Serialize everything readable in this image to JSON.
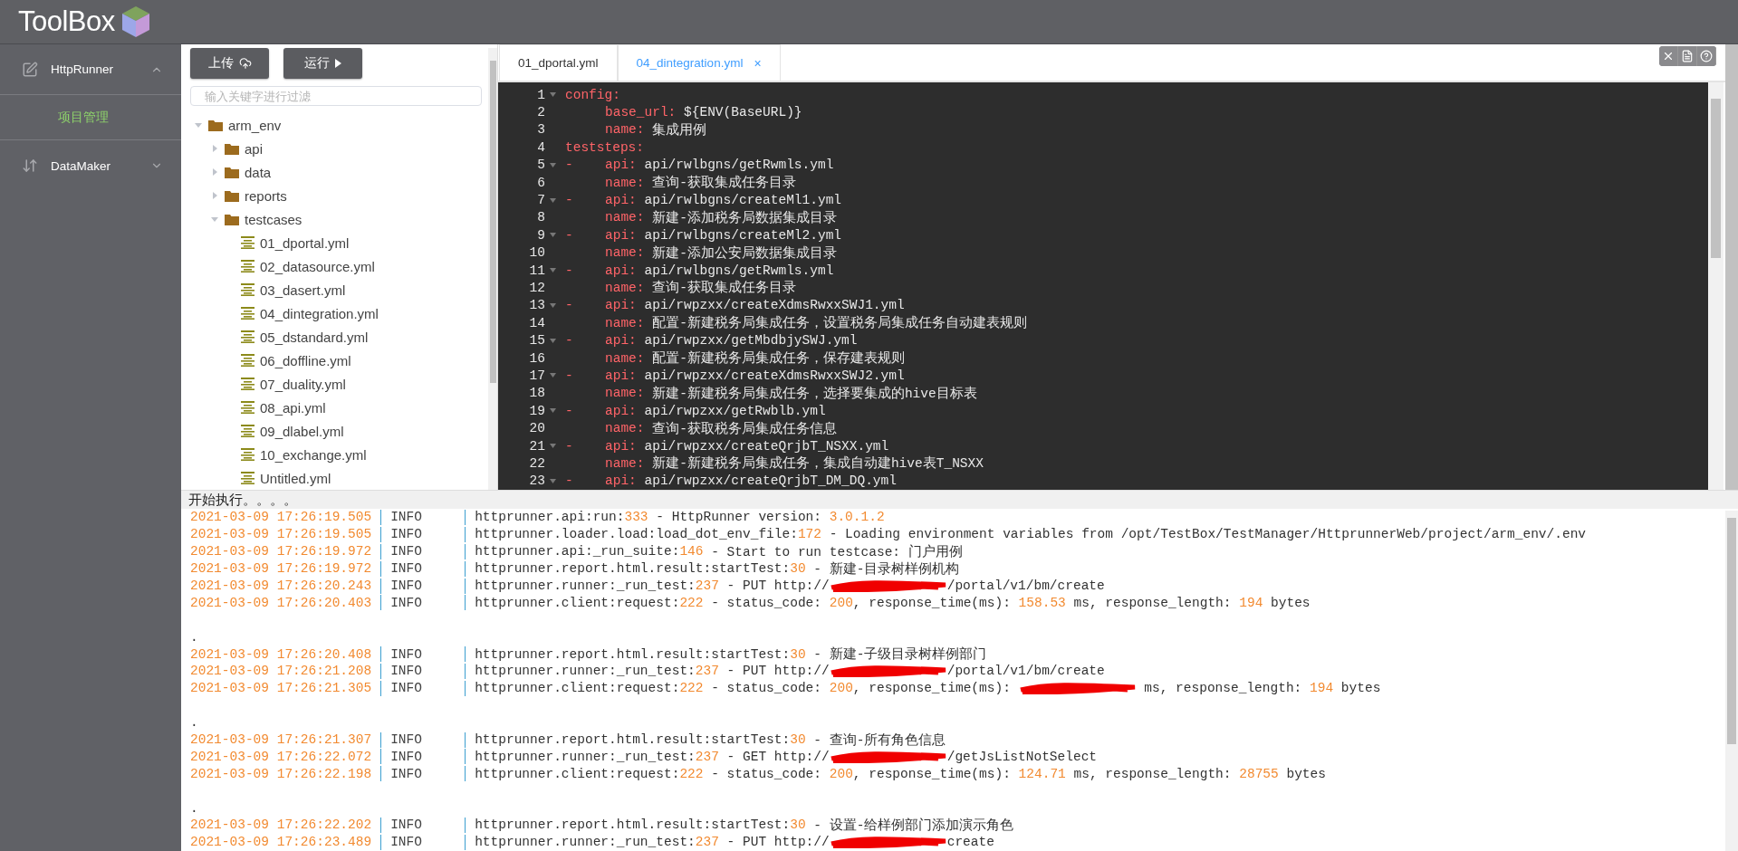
{
  "app": {
    "title": "ToolBox"
  },
  "sidebar": {
    "menus": [
      {
        "label": "HttpRunner",
        "expanded": true,
        "children": [
          {
            "label": "项目管理",
            "selected": true
          }
        ]
      },
      {
        "label": "DataMaker",
        "expanded": false
      }
    ]
  },
  "toolbar": {
    "buttons": [
      {
        "label": "上传",
        "kind": "upload"
      },
      {
        "label": "运行",
        "kind": "run"
      }
    ]
  },
  "filter": {
    "placeholder": "输入关键字进行过滤"
  },
  "file_tree": [
    {
      "label": "arm_env",
      "kind": "folder",
      "expanded": true,
      "children": [
        {
          "label": "api",
          "kind": "folder",
          "expanded": false
        },
        {
          "label": "data",
          "kind": "folder",
          "expanded": false
        },
        {
          "label": "reports",
          "kind": "folder",
          "expanded": false
        },
        {
          "label": "testcases",
          "kind": "folder",
          "expanded": true,
          "children": [
            {
              "label": "01_dportal.yml",
              "kind": "file"
            },
            {
              "label": "02_datasource.yml",
              "kind": "file"
            },
            {
              "label": "03_dasert.yml",
              "kind": "file"
            },
            {
              "label": "04_dintegration.yml",
              "kind": "file"
            },
            {
              "label": "05_dstandard.yml",
              "kind": "file"
            },
            {
              "label": "06_doffline.yml",
              "kind": "file"
            },
            {
              "label": "07_duality.yml",
              "kind": "file"
            },
            {
              "label": "08_api.yml",
              "kind": "file"
            },
            {
              "label": "09_dlabel.yml",
              "kind": "file"
            },
            {
              "label": "10_exchange.yml",
              "kind": "file"
            },
            {
              "label": "Untitled.yml",
              "kind": "file"
            }
          ]
        }
      ]
    }
  ],
  "editor": {
    "tabs": [
      {
        "label": "01_dportal.yml",
        "selected": false
      },
      {
        "label": "04_dintegration.yml",
        "selected": true,
        "close": "×"
      }
    ],
    "lines": [
      {
        "no": "1",
        "fold": true,
        "kind": "top",
        "key": "config:"
      },
      {
        "no": "2",
        "fold": false,
        "kind": "field",
        "key": "base_url:",
        "value": "${ENV(BaseURL)}"
      },
      {
        "no": "3",
        "fold": false,
        "kind": "field",
        "key": "name:",
        "value": "集成用例"
      },
      {
        "no": "4",
        "fold": false,
        "kind": "top",
        "key": "teststeps:"
      },
      {
        "no": "5",
        "fold": true,
        "kind": "item",
        "dash": "-",
        "key": "api:",
        "value": "api/rwlbgns/getRwmls.yml"
      },
      {
        "no": "6",
        "fold": false,
        "kind": "field",
        "key": "name:",
        "value": "查询-获取集成任务目录"
      },
      {
        "no": "7",
        "fold": true,
        "kind": "item",
        "dash": "-",
        "key": "api:",
        "value": "api/rwlbgns/createMl1.yml"
      },
      {
        "no": "8",
        "fold": false,
        "kind": "field",
        "key": "name:",
        "value": "新建-添加税务局数据集成目录"
      },
      {
        "no": "9",
        "fold": true,
        "kind": "item",
        "dash": "-",
        "key": "api:",
        "value": "api/rwlbgns/createMl2.yml"
      },
      {
        "no": "10",
        "fold": false,
        "kind": "field",
        "key": "name:",
        "value": "新建-添加公安局数据集成目录"
      },
      {
        "no": "11",
        "fold": true,
        "kind": "item",
        "dash": "-",
        "key": "api:",
        "value": "api/rwlbgns/getRwmls.yml"
      },
      {
        "no": "12",
        "fold": false,
        "kind": "field",
        "key": "name:",
        "value": "查询-获取集成任务目录"
      },
      {
        "no": "13",
        "fold": true,
        "kind": "item",
        "dash": "-",
        "key": "api:",
        "value": "api/rwpzxx/createXdmsRwxxSWJ1.yml"
      },
      {
        "no": "14",
        "fold": false,
        "kind": "field",
        "key": "name:",
        "value": "配置-新建税务局集成任务，设置税务局集成任务自动建表规则"
      },
      {
        "no": "15",
        "fold": true,
        "kind": "item",
        "dash": "-",
        "key": "api:",
        "value": "api/rwpzxx/getMbdbjySWJ.yml"
      },
      {
        "no": "16",
        "fold": false,
        "kind": "field",
        "key": "name:",
        "value": "配置-新建税务局集成任务，保存建表规则"
      },
      {
        "no": "17",
        "fold": true,
        "kind": "item",
        "dash": "-",
        "key": "api:",
        "value": "api/rwpzxx/createXdmsRwxxSWJ2.yml"
      },
      {
        "no": "18",
        "fold": false,
        "kind": "field",
        "key": "name:",
        "value": "新建-新建税务局集成任务，选择要集成的hive目标表"
      },
      {
        "no": "19",
        "fold": true,
        "kind": "item",
        "dash": "-",
        "key": "api:",
        "value": "api/rwpzxx/getRwblb.yml"
      },
      {
        "no": "20",
        "fold": false,
        "kind": "field",
        "key": "name:",
        "value": "查询-获取税务局集成任务信息"
      },
      {
        "no": "21",
        "fold": true,
        "kind": "item",
        "dash": "-",
        "key": "api:",
        "value": "api/rwpzxx/createQrjbT_NSXX.yml"
      },
      {
        "no": "22",
        "fold": false,
        "kind": "field",
        "key": "name:",
        "value": "新建-新建税务局集成任务，集成自动建hive表T_NSXX"
      },
      {
        "no": "23",
        "fold": true,
        "kind": "item",
        "dash": "-",
        "key": "api:",
        "value": "api/rwpzxx/createQrjbT_DM_DQ.yml"
      }
    ]
  },
  "log": {
    "title": "开始执行。。。。",
    "lines": [
      {
        "kind": "entry",
        "time": "2021-03-09 17:26:19.505",
        "level": "INFO",
        "parts": [
          "httprunner.api:run:",
          "333",
          " - HttpRunner version: ",
          "3.0.1.2"
        ]
      },
      {
        "kind": "entry",
        "time": "2021-03-09 17:26:19.505",
        "level": "INFO",
        "parts": [
          "httprunner.loader.load:load_dot_env_file:",
          "172",
          " - Loading environment variables from /opt/TestBox/TestManager/HttprunnerWeb/project/arm_env/.env"
        ]
      },
      {
        "kind": "entry",
        "time": "2021-03-09 17:26:19.972",
        "level": "INFO",
        "parts": [
          "httprunner.api:_run_suite:",
          "146",
          " - Start to run testcase: 门户用例"
        ]
      },
      {
        "kind": "entry",
        "time": "2021-03-09 17:26:19.972",
        "level": "INFO",
        "parts": [
          "httprunner.report.html.result:startTest:",
          "30",
          " - 新建-目录树样例机构"
        ]
      },
      {
        "kind": "entry",
        "time": "2021-03-09 17:26:20.243",
        "level": "INFO",
        "parts": [
          "httprunner.runner:_run_test:",
          "237",
          " - PUT http://",
          {
            "kind": "redaction"
          },
          "/portal/v1/bm/create"
        ]
      },
      {
        "kind": "entry",
        "time": "2021-03-09 17:26:20.403",
        "level": "INFO",
        "parts": [
          "httprunner.client:request:",
          "222",
          " - status_code: ",
          "200",
          ", response_time(ms): ",
          "158.53",
          " ms, response_length: ",
          "194",
          " bytes"
        ]
      },
      {
        "kind": "blank"
      },
      {
        "kind": "dot",
        "text": "."
      },
      {
        "kind": "entry",
        "time": "2021-03-09 17:26:20.408",
        "level": "INFO",
        "parts": [
          "httprunner.report.html.result:startTest:",
          "30",
          " - 新建-子级目录树样例部门"
        ]
      },
      {
        "kind": "entry",
        "time": "2021-03-09 17:26:21.208",
        "level": "INFO",
        "parts": [
          "httprunner.runner:_run_test:",
          "237",
          " - PUT http://",
          {
            "kind": "redaction"
          },
          "/portal/v1/bm/create"
        ]
      },
      {
        "kind": "entry",
        "time": "2021-03-09 17:26:21.305",
        "level": "INFO",
        "parts": [
          "httprunner.client:request:",
          "222",
          " - status_code: ",
          "200",
          ", response_time(ms): ",
          {
            "kind": "redaction"
          },
          " ms, response_length: ",
          "194",
          " bytes"
        ]
      },
      {
        "kind": "blank"
      },
      {
        "kind": "dot",
        "text": "."
      },
      {
        "kind": "entry",
        "time": "2021-03-09 17:26:21.307",
        "level": "INFO",
        "parts": [
          "httprunner.report.html.result:startTest:",
          "30",
          " - 查询-所有角色信息"
        ]
      },
      {
        "kind": "entry",
        "time": "2021-03-09 17:26:22.072",
        "level": "INFO",
        "parts": [
          "httprunner.runner:_run_test:",
          "237",
          " - GET http://",
          {
            "kind": "redaction"
          },
          "/getJsListNotSelect"
        ]
      },
      {
        "kind": "entry",
        "time": "2021-03-09 17:26:22.198",
        "level": "INFO",
        "parts": [
          "httprunner.client:request:",
          "222",
          " - status_code: ",
          "200",
          ", response_time(ms): ",
          "124.71",
          " ms, response_length: ",
          "28755",
          " bytes"
        ]
      },
      {
        "kind": "blank"
      },
      {
        "kind": "dot",
        "text": "."
      },
      {
        "kind": "entry",
        "time": "2021-03-09 17:26:22.202",
        "level": "INFO",
        "parts": [
          "httprunner.report.html.result:startTest:",
          "30",
          " - 设置-给样例部门添加演示角色"
        ]
      },
      {
        "kind": "entry",
        "time": "2021-03-09 17:26:23.489",
        "level": "INFO",
        "parts": [
          "httprunner.runner:_run_test:",
          "237",
          " - PUT http://",
          {
            "kind": "redaction"
          },
          "create"
        ]
      }
    ]
  }
}
